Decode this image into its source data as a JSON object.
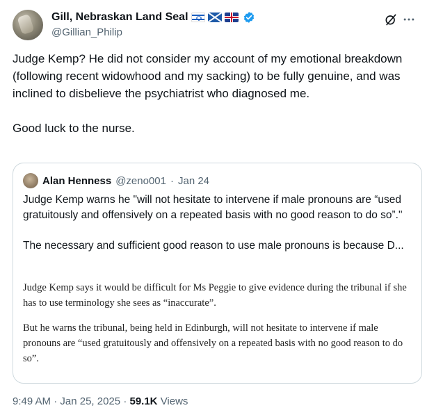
{
  "author": {
    "display_name": "Gill, Nebraskan Land Seal",
    "handle": "@Gillian_Philip",
    "flags": [
      "israel-flag",
      "scotland-flag",
      "uk-flag"
    ],
    "verified": true,
    "verified_color": "#1d9bf0"
  },
  "tweet": {
    "paragraphs": [
      "Judge Kemp? He did not consider my account of my emotional breakdown (following recent widowhood and my sacking) to be fully genuine, and was inclined to disbelieve the psychiatrist who diagnosed me.",
      "Good luck to the nurse."
    ]
  },
  "quote": {
    "display_name": "Alan Henness",
    "handle": "@zeno001",
    "separator": "·",
    "date": "Jan 24",
    "paragraphs": [
      "Judge Kemp warns he \"will not hesitate to intervene if male pronouns are “used gratuitously and offensively on a repeated basis with no good reason to do so”.\"",
      "The necessary and sufficient good reason to use male pronouns is because D..."
    ],
    "article_paragraphs": [
      "Judge Kemp says it would be difficult for Ms Peggie to give evidence during the tribunal if she has to use terminology she sees as “inaccurate”.",
      "But he warns the tribunal, being held in Edinburgh, will not hesitate to intervene if male pronouns are “used gratuitously and offensively on a repeated basis with no good reason to do so”."
    ]
  },
  "meta": {
    "time": "9:49 AM",
    "separator": "·",
    "date": "Jan 25, 2025",
    "dot": "·",
    "views_count": "59.1K",
    "views_label": "Views"
  },
  "colors": {
    "text": "#0f1419",
    "secondary": "#536471",
    "border": "#cfd9de"
  }
}
